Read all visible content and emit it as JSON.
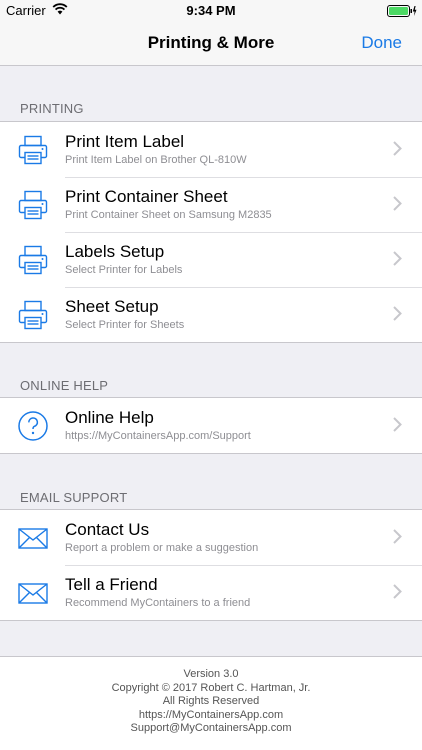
{
  "status_bar": {
    "carrier": "Carrier",
    "time": "9:34 PM",
    "wifi_icon": "wifi-icon",
    "battery_icon": "battery-icon"
  },
  "nav_bar": {
    "title": "Printing & More",
    "done_label": "Done"
  },
  "sections": {
    "printing": {
      "header": "PRINTING",
      "items": [
        {
          "title": "Print Item Label",
          "subtitle": "Print Item Label on Brother QL-810W",
          "icon": "printer-icon"
        },
        {
          "title": "Print Container Sheet",
          "subtitle": "Print Container Sheet on Samsung M2835",
          "icon": "printer-icon"
        },
        {
          "title": "Labels Setup",
          "subtitle": "Select Printer for Labels",
          "icon": "printer-icon"
        },
        {
          "title": "Sheet Setup",
          "subtitle": "Select Printer for Sheets",
          "icon": "printer-icon"
        }
      ]
    },
    "online_help": {
      "header": "ONLINE HELP",
      "items": [
        {
          "title": "Online Help",
          "subtitle": "https://MyContainersApp.com/Support",
          "icon": "help-icon"
        }
      ]
    },
    "email_support": {
      "header": "EMAIL SUPPORT",
      "items": [
        {
          "title": "Contact Us",
          "subtitle": "Report a problem or make a suggestion",
          "icon": "envelope-icon"
        },
        {
          "title": "Tell a Friend",
          "subtitle": "Recommend MyContainers to a friend",
          "icon": "envelope-icon"
        }
      ]
    }
  },
  "footer": {
    "version": "Version 3.0",
    "copyright": "Copyright © 2017  Robert C. Hartman, Jr.",
    "rights": "All Rights Reserved",
    "website": "https://MyContainersApp.com",
    "email": "Support@MyContainersApp.com"
  },
  "colors": {
    "accent": "#1a7ae6",
    "battery": "#4cd964"
  }
}
